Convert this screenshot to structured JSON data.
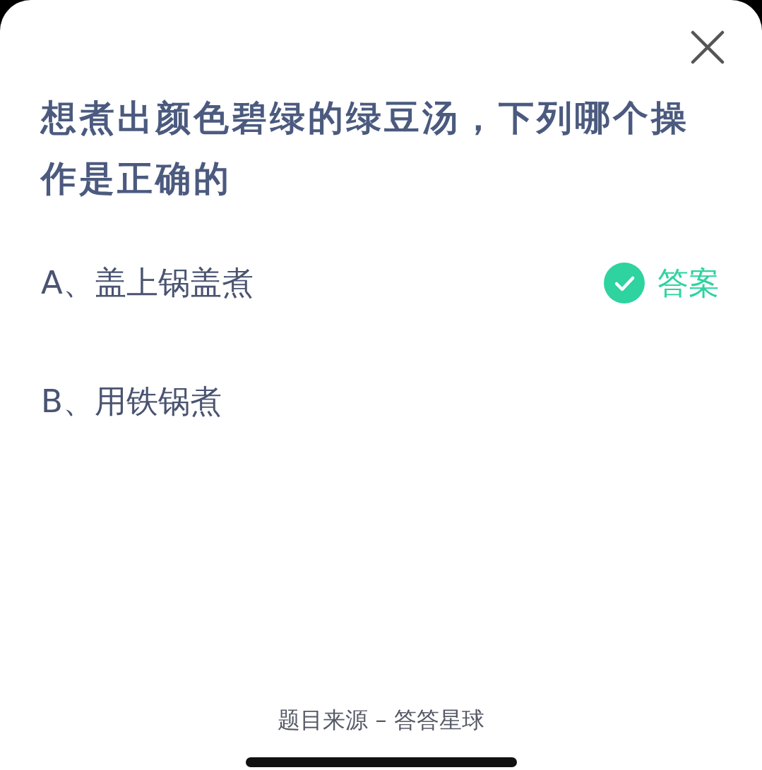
{
  "question": "想煮出颜色碧绿的绿豆汤，下列哪个操作是正确的",
  "answer_label": "答案",
  "options": [
    {
      "text": "A、盖上锅盖煮",
      "correct": true
    },
    {
      "text": "B、用铁锅煮",
      "correct": false
    }
  ],
  "footer": "题目来源 – 答答星球"
}
